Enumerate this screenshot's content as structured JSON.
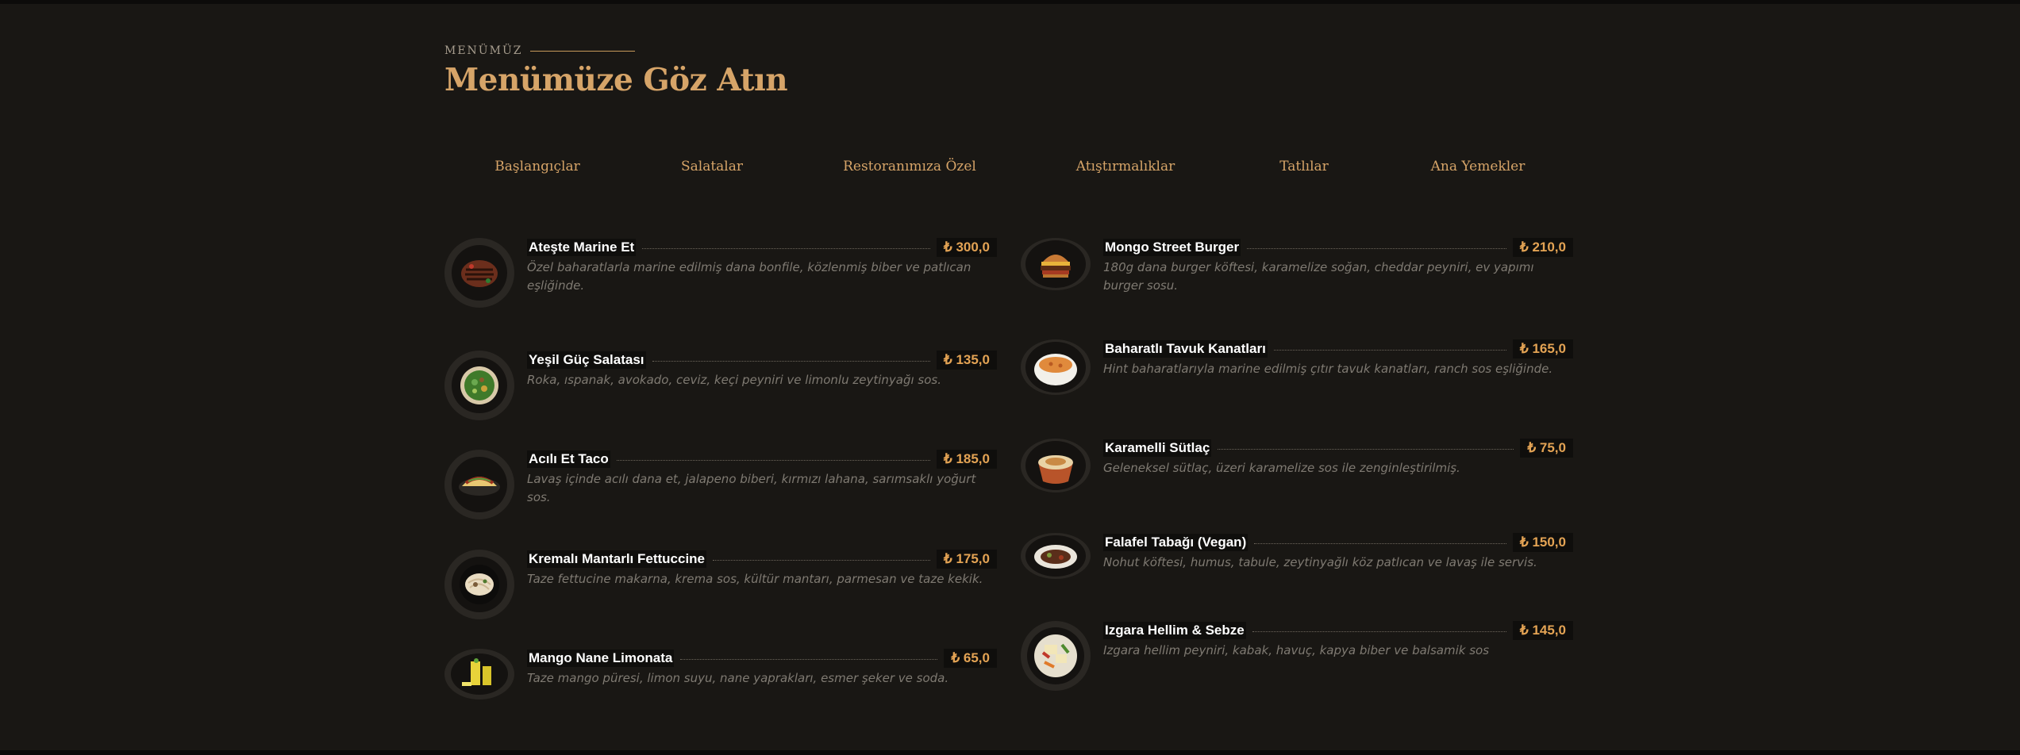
{
  "section": {
    "eyebrow": "MENÜMÜZ",
    "title": "Menümüze Göz Atın"
  },
  "tabs": [
    "Başlangıçlar",
    "Salatalar",
    "Restoranımıza Özel",
    "Atıştırmalıklar",
    "Tatlılar",
    "Ana Yemekler"
  ],
  "currency": "₺",
  "left_items": [
    {
      "name": "Ateşte Marine Et",
      "price": "₺ 300,0",
      "desc": "Özel baharatlarla marine edilmiş dana bonfile, közlenmiş biber ve patlıcan eşliğinde.",
      "icon": "grilled-steak-icon"
    },
    {
      "name": "Yeşil Güç Salatası",
      "price": "₺ 135,0",
      "desc": "Roka, ıspanak, avokado, ceviz, keçi peyniri ve limonlu zeytinyağı sos.",
      "icon": "green-salad-icon"
    },
    {
      "name": "Acılı Et Taco",
      "price": "₺ 185,0",
      "desc": "Lavaş içinde acılı dana et, jalapeno biberi, kırmızı lahana, sarımsaklı yoğurt sos.",
      "icon": "taco-icon"
    },
    {
      "name": "Kremalı Mantarlı Fettuccine",
      "price": "₺ 175,0",
      "desc": "Taze fettucine makarna, krema sos, kültür mantarı, parmesan ve taze kekik.",
      "icon": "pasta-icon"
    },
    {
      "name": "Mango Nane Limonata",
      "price": "₺ 65,0",
      "desc": "Taze mango püresi, limon suyu, nane yaprakları, esmer şeker ve soda.",
      "icon": "lemonade-icon"
    }
  ],
  "right_items": [
    {
      "name": "Mongo Street Burger",
      "price": "₺ 210,0",
      "desc": "180g dana burger köftesi, karamelize soğan, cheddar peyniri, ev yapımı burger sosu.",
      "icon": "burger-icon"
    },
    {
      "name": "Baharatlı Tavuk Kanatları",
      "price": "₺ 165,0",
      "desc": "Hint baharatlarıyla marine edilmiş çıtır tavuk kanatları, ranch sos eşliğinde.",
      "icon": "chicken-wings-icon"
    },
    {
      "name": "Karamelli Sütlaç",
      "price": "₺ 75,0",
      "desc": "Geleneksel sütlaç, üzeri karamelize sos ile zenginleştirilmiş.",
      "icon": "rice-pudding-icon"
    },
    {
      "name": "Falafel Tabağı (Vegan)",
      "price": "₺ 150,0",
      "desc": "Nohut köftesi, humus, tabule, zeytinyağlı köz patlıcan ve lavaş ile servis.",
      "icon": "falafel-plate-icon"
    },
    {
      "name": "Izgara Hellim & Sebze",
      "price": "₺ 145,0",
      "desc": "Izgara hellim peyniri, kabak, havuç, kapya biber ve balsamik sos",
      "icon": "grilled-halloumi-icon"
    }
  ],
  "colors": {
    "background": "#191714",
    "accent": "#d6a468",
    "price": "#e3a354",
    "description": "#7f7a72"
  }
}
